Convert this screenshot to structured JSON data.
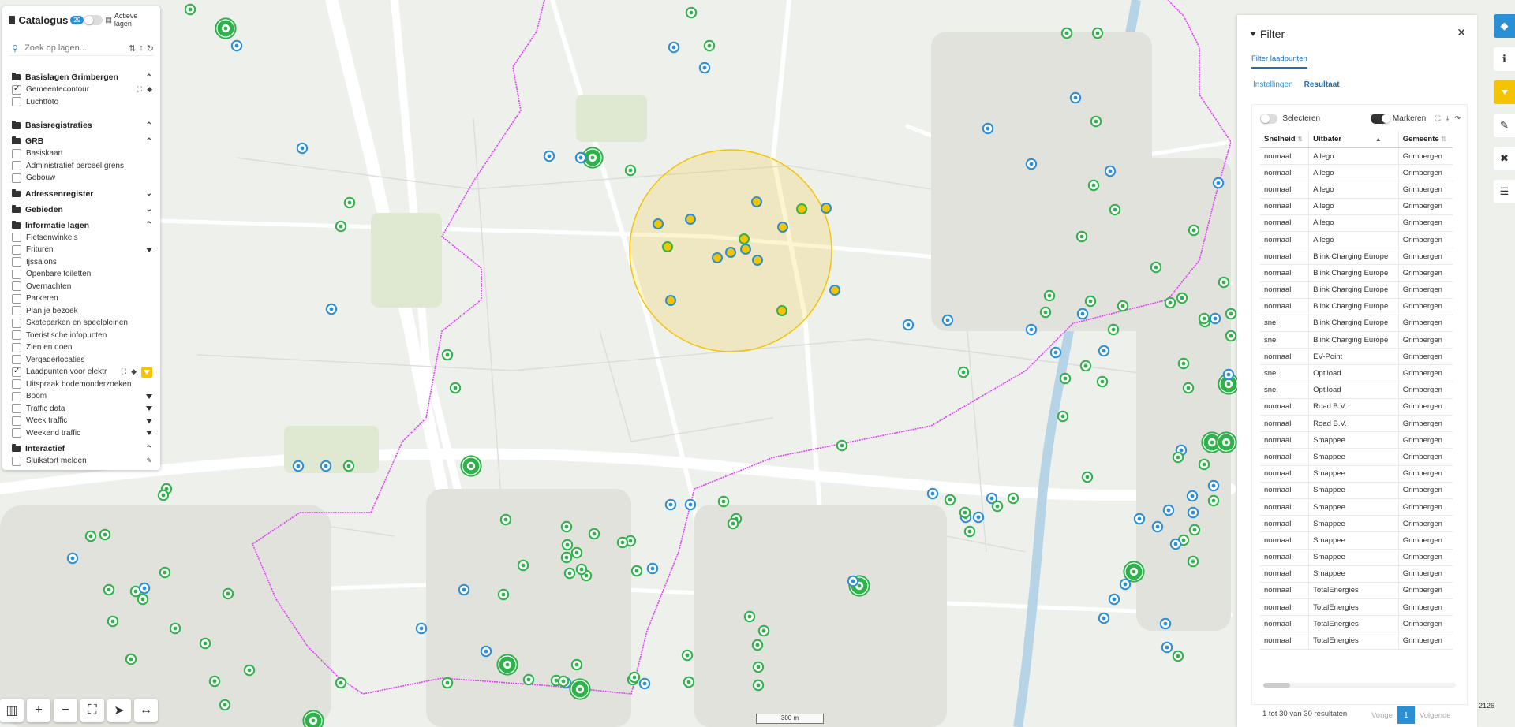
{
  "catalog": {
    "title": "Catalogus",
    "badge": "29",
    "active_layers_label": "Actieve lagen",
    "search_placeholder": "Zoek op lagen...",
    "groups": [
      {
        "name": "Basislagen Grimbergen",
        "items": [
          {
            "label": "Gemeentecontour",
            "checked": true
          },
          {
            "label": "Luchtfoto",
            "checked": false
          }
        ]
      },
      {
        "name": "Basisregistraties",
        "items": []
      },
      {
        "name": "GRB",
        "items": [
          {
            "label": "Basiskaart",
            "checked": false
          },
          {
            "label": "Administratief perceel grens",
            "checked": false
          },
          {
            "label": "Gebouw",
            "checked": false
          }
        ]
      },
      {
        "name": "Adressenregister",
        "items": []
      },
      {
        "name": "Gebieden",
        "items": []
      },
      {
        "name": "Informatie lagen",
        "items": [
          {
            "label": "Fietsenwinkels",
            "checked": false
          },
          {
            "label": "Frituren",
            "checked": false
          },
          {
            "label": "Ijssalons",
            "checked": false
          },
          {
            "label": "Openbare toiletten",
            "checked": false
          },
          {
            "label": "Overnachten",
            "checked": false
          },
          {
            "label": "Parkeren",
            "checked": false
          },
          {
            "label": "Plan je bezoek",
            "checked": false
          },
          {
            "label": "Skateparken en speelpleinen",
            "checked": false
          },
          {
            "label": "Toeristische infopunten",
            "checked": false
          },
          {
            "label": "Zien en doen",
            "checked": false
          },
          {
            "label": "Vergaderlocaties",
            "checked": false
          },
          {
            "label": "Laadpunten voor elektr",
            "checked": true
          },
          {
            "label": "Uitspraak bodemonderzoeken",
            "checked": false
          },
          {
            "label": "Boom",
            "checked": false
          },
          {
            "label": "Traffic data",
            "checked": false
          },
          {
            "label": "Week traffic",
            "checked": false
          },
          {
            "label": "Weekend traffic",
            "checked": false
          }
        ]
      },
      {
        "name": "Interactief",
        "items": [
          {
            "label": "Sluikstort melden",
            "checked": false
          }
        ]
      }
    ]
  },
  "filter": {
    "title": "Filter",
    "tab": "Filter laadpunten",
    "subtabs": [
      "Instellingen",
      "Resultaat"
    ],
    "select_label": "Selecteren",
    "mark_label": "Markeren",
    "columns": [
      "Snelheid",
      "Uitbater",
      "Gemeente"
    ],
    "rows": [
      [
        "normaal",
        "Allego",
        "Grimbergen"
      ],
      [
        "normaal",
        "Allego",
        "Grimbergen"
      ],
      [
        "normaal",
        "Allego",
        "Grimbergen"
      ],
      [
        "normaal",
        "Allego",
        "Grimbergen"
      ],
      [
        "normaal",
        "Allego",
        "Grimbergen"
      ],
      [
        "normaal",
        "Allego",
        "Grimbergen"
      ],
      [
        "normaal",
        "Blink Charging Europe",
        "Grimbergen"
      ],
      [
        "normaal",
        "Blink Charging Europe",
        "Grimbergen"
      ],
      [
        "normaal",
        "Blink Charging Europe",
        "Grimbergen"
      ],
      [
        "normaal",
        "Blink Charging Europe",
        "Grimbergen"
      ],
      [
        "snel",
        "Blink Charging Europe",
        "Grimbergen"
      ],
      [
        "snel",
        "Blink Charging Europe",
        "Grimbergen"
      ],
      [
        "normaal",
        "EV-Point",
        "Grimbergen"
      ],
      [
        "snel",
        "Optiload",
        "Grimbergen"
      ],
      [
        "snel",
        "Optiload",
        "Grimbergen"
      ],
      [
        "normaal",
        "Road B.V.",
        "Grimbergen"
      ],
      [
        "normaal",
        "Road B.V.",
        "Grimbergen"
      ],
      [
        "normaal",
        "Smappee",
        "Grimbergen"
      ],
      [
        "normaal",
        "Smappee",
        "Grimbergen"
      ],
      [
        "normaal",
        "Smappee",
        "Grimbergen"
      ],
      [
        "normaal",
        "Smappee",
        "Grimbergen"
      ],
      [
        "normaal",
        "Smappee",
        "Grimbergen"
      ],
      [
        "normaal",
        "Smappee",
        "Grimbergen"
      ],
      [
        "normaal",
        "Smappee",
        "Grimbergen"
      ],
      [
        "normaal",
        "Smappee",
        "Grimbergen"
      ],
      [
        "normaal",
        "Smappee",
        "Grimbergen"
      ],
      [
        "normaal",
        "TotalEnergies",
        "Grimbergen"
      ],
      [
        "normaal",
        "TotalEnergies",
        "Grimbergen"
      ],
      [
        "normaal",
        "TotalEnergies",
        "Grimbergen"
      ],
      [
        "normaal",
        "TotalEnergies",
        "Grimbergen"
      ]
    ],
    "result_count": "1 tot 30 van 30 resultaten",
    "pager": {
      "prev": "Vorige",
      "page": "1",
      "next": "Volgende"
    }
  },
  "map": {
    "scale_label": "300 m",
    "minimap_label": "2126",
    "accent_yellow": "#f4c400",
    "accent_blue": "#2b8fd6",
    "boundary_color": "#e040fb",
    "green_marker": "#2db34a"
  }
}
